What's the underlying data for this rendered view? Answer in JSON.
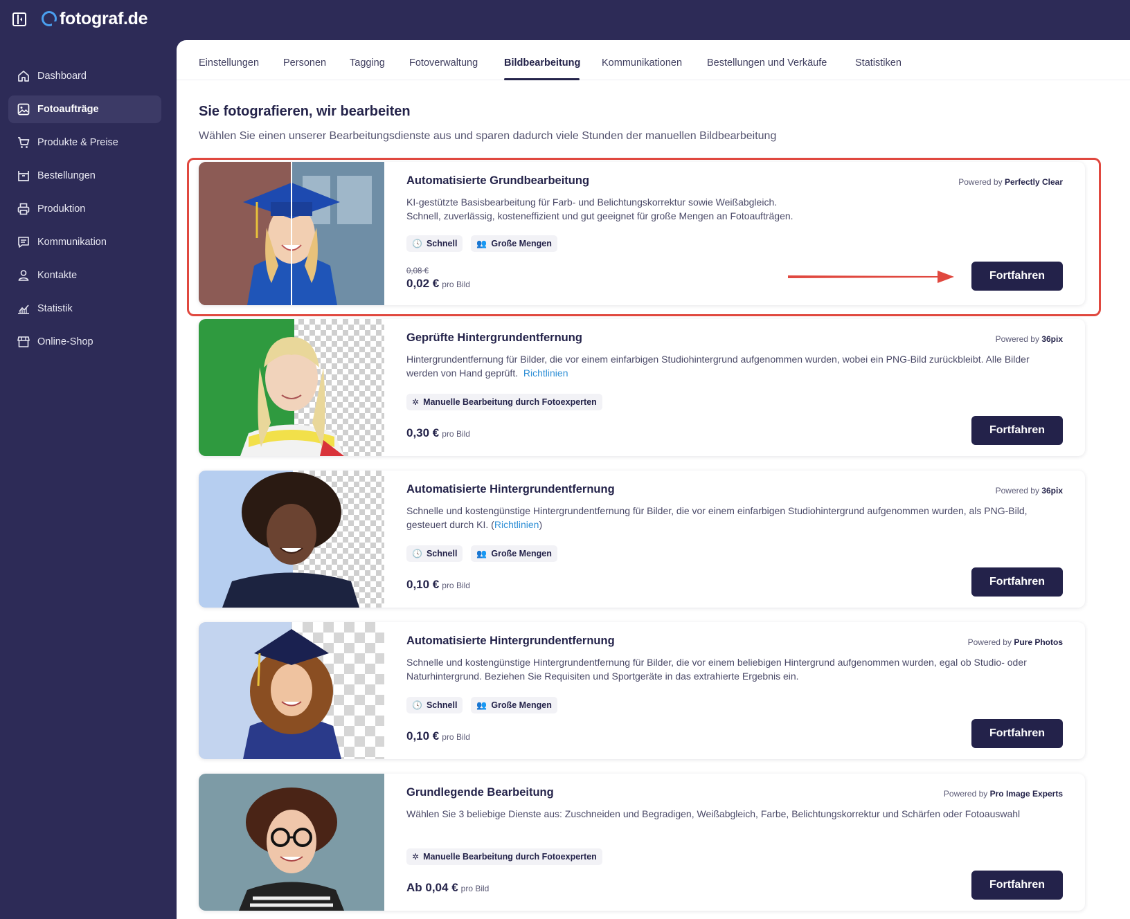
{
  "app": {
    "logo_text": "fotograf.de"
  },
  "sidebar": {
    "items": [
      {
        "label": "Dashboard",
        "icon": "home-icon"
      },
      {
        "label": "Fotoaufträge",
        "icon": "image-icon",
        "active": true
      },
      {
        "label": "Produkte & Preise",
        "icon": "cart-icon"
      },
      {
        "label": "Bestellungen",
        "icon": "box-icon"
      },
      {
        "label": "Produktion",
        "icon": "printer-icon"
      },
      {
        "label": "Kommunikation",
        "icon": "message-icon"
      },
      {
        "label": "Kontakte",
        "icon": "person-icon"
      },
      {
        "label": "Statistik",
        "icon": "chart-icon"
      },
      {
        "label": "Online-Shop",
        "icon": "store-icon"
      }
    ]
  },
  "tabs": [
    "Einstellungen",
    "Personen",
    "Tagging",
    "Fotoverwaltung",
    "Bildbearbeitung",
    "Kommunikationen",
    "Bestellungen und Verkäufe",
    "Statistiken"
  ],
  "active_tab": "Bildbearbeitung",
  "page": {
    "title": "Sie fotografieren, wir bearbeiten",
    "subtitle": "Wählen Sie einen unserer Bearbeitungsdienste aus und sparen dadurch viele Stunden der manuellen Bildbearbeitung"
  },
  "cards": [
    {
      "title": "Automatisierte Grundbearbeitung",
      "powered_prefix": "Powered by",
      "powered_by": "Perfectly Clear",
      "desc_line1": "KI-gestützte Basisbearbeitung für Farb- und Belichtungskorrektur sowie Weißabgleich.",
      "desc_line2": "Schnell, zuverlässig, kosteneffizient und gut geeignet für große Mengen an Fotoaufträgen.",
      "chips": [
        "Schnell",
        "Große Mengen"
      ],
      "old_price": "0,08 €",
      "price": "0,02 €",
      "price_unit": "pro Bild",
      "button": "Fortfahren"
    },
    {
      "title": "Geprüfte Hintergrundentfernung",
      "powered_prefix": "Powered by",
      "powered_by": "36pix",
      "desc": "Hintergrundentfernung für Bilder, die vor einem einfarbigen Studiohintergrund aufgenommen wurden, wobei ein PNG-Bild zurückbleibt. Alle Bilder werden von Hand geprüft.",
      "link": "Richtlinien",
      "chips": [
        "Manuelle Bearbeitung durch Fotoexperten"
      ],
      "price": "0,30 €",
      "price_unit": "pro Bild",
      "button": "Fortfahren"
    },
    {
      "title": "Automatisierte Hintergrundentfernung",
      "powered_prefix": "Powered by",
      "powered_by": "36pix",
      "desc": "Schnelle und kostengünstige Hintergrundentfernung für Bilder, die vor einem einfarbigen Studiohintergrund aufgenommen wurden, als PNG-Bild, gesteuert durch KI. (",
      "link": "Richtlinien",
      "desc_after_link": ")",
      "chips": [
        "Schnell",
        "Große Mengen"
      ],
      "price": "0,10 €",
      "price_unit": "pro Bild",
      "button": "Fortfahren"
    },
    {
      "title": "Automatisierte Hintergrundentfernung",
      "powered_prefix": "Powered by",
      "powered_by": "Pure Photos",
      "desc": "Schnelle und kostengünstige Hintergrundentfernung für Bilder, die vor einem beliebigen Hintergrund aufgenommen wurden, egal ob Studio- oder Naturhintergrund. Beziehen Sie Requisiten und Sportgeräte in das extrahierte Ergebnis ein.",
      "chips": [
        "Schnell",
        "Große Mengen"
      ],
      "price": "0,10 €",
      "price_unit": "pro Bild",
      "button": "Fortfahren"
    },
    {
      "title": "Grundlegende Bearbeitung",
      "powered_prefix": "Powered by",
      "powered_by": "Pro Image Experts",
      "desc": "Wählen Sie 3 beliebige Dienste aus: Zuschneiden und Begradigen, Weißabgleich, Farbe, Belichtungskorrektur und Schärfen oder Fotoauswahl",
      "chips": [
        "Manuelle Bearbeitung durch Fotoexperten"
      ],
      "price": "Ab 0,04 €",
      "price_unit": "pro Bild",
      "button": "Fortfahren"
    }
  ],
  "colors": {
    "sidebar_bg": "#2d2b57",
    "button_bg": "#23224a",
    "highlight": "#e0483f",
    "link": "#2f8fd6",
    "logo_accent": "#4a9ff0"
  }
}
